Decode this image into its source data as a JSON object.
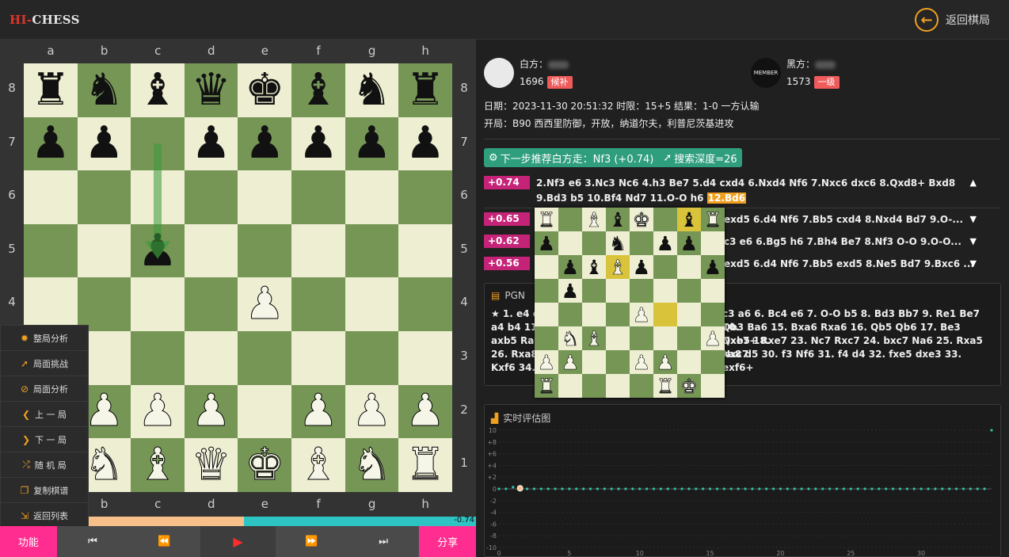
{
  "header": {
    "logo_red": "HI-",
    "logo_white": "CHESS",
    "back_label": "返回棋局",
    "back_icon": "arrow-left-circle-icon"
  },
  "board": {
    "files": [
      "a",
      "b",
      "c",
      "d",
      "e",
      "f",
      "g",
      "h"
    ],
    "ranks": [
      "8",
      "7",
      "6",
      "5",
      "4",
      "3",
      "2",
      "1"
    ],
    "rows": [
      "rnbqkbnr",
      "pp.ppppp",
      "........",
      "..p.....",
      "....P...",
      "........",
      "PPPP.PPP",
      "RNBQKBNR"
    ],
    "arrow": {
      "from": "c7",
      "to": "c5",
      "color": "#3a9a3a"
    }
  },
  "menu": [
    {
      "icon": "gear-icon",
      "label": "整局分析"
    },
    {
      "icon": "rocket-icon",
      "label": "局面挑战"
    },
    {
      "icon": "eye-slash-icon",
      "label": "局面分析"
    },
    {
      "icon": "chevron-left-icon",
      "label": "上 一 局"
    },
    {
      "icon": "chevron-right-icon",
      "label": "下 一 局"
    },
    {
      "icon": "shuffle-icon",
      "label": "随 机 局"
    },
    {
      "icon": "copy-icon",
      "label": "复制棋谱"
    },
    {
      "icon": "sign-out-icon",
      "label": "返回列表"
    }
  ],
  "evalbar": {
    "white_fraction": 0.4,
    "label": "-0.74"
  },
  "controls": {
    "func_label": "功能",
    "share_label": "分享",
    "first_icon": "skip-start-icon",
    "prev_icon": "rewind-icon",
    "play_icon": "play-icon",
    "next_icon": "fast-forward-icon",
    "last_icon": "skip-end-icon"
  },
  "players": {
    "white": {
      "side": "白方：",
      "rating": "1696",
      "badge": "候补"
    },
    "black": {
      "side": "黑方：",
      "rating": "1573",
      "badge": "一级",
      "avatar_text": "MEMBER"
    }
  },
  "meta": {
    "line1": "日期：2023-11-30 20:51:32 时限：15+5 结果：1-0 一方认输",
    "line2": "开局：B90 西西里防御，开放，纳道尔夫，利普尼茨基进攻"
  },
  "recommend": {
    "text": "下一步推荐白方走：Nf3 (+0.74)",
    "depth": "搜索深度=26"
  },
  "lines": [
    {
      "score": "+0.74",
      "moves": "2.Nf3 e6 3.Nc3 Nc6 4.h3 Be7 5.d4 cxd4 6.Nxd4 Nf6 7.Nxc6 dxc6 8.Qxd8+ Bxd8 9.Bd3 b5 10.Bf4 Nd7 11.O-O h6",
      "highlight": "12.Bd6"
    },
    {
      "score": "+0.65",
      "moves": "exd5 6.d4 Nf6 7.Bb5 cxd4 8.Nxd4 Bd7 9.O-..."
    },
    {
      "score": "+0.62",
      "moves": "c3 e6 6.Bg5 h6 7.Bh4 Be7 8.Nf3 O-O 9.O-O..."
    },
    {
      "score": "+0.56",
      "moves": "exd5 6.d4 Nf6 7.Bb5 exd5 8.Ne5 Bd7 9.Bxc6 ..."
    }
  ],
  "pgn": {
    "title": "PGN",
    "row1a": "★ 1. e4 c",
    "row1b": "c3 a6 6. Bc4 e6 7. O-O b5 8. Bd3 Bb7 9. Re1 Be7 10.",
    "row2a": "a4 b4 11.",
    "row2b": "Qb3 Ba6 15. Bxa6 Rxa6 16. Qb5 Qb6 17. Be3 Qxb5 18.",
    "row3a": "axb5 Ra6",
    "row3b": "Nxe7+ Rxe7 23. Nc7 Rxc7 24. bxc7 Na6 25. Rxa5 Nxc7",
    "row4a": "26. Rxa8",
    "row4b": "xa8 d5 30. f3 Nf6 31. f4 d4 32. fxe5 dxe3 33. exf6+",
    "row5a": "Kxf6 34."
  },
  "chart": {
    "title": "实时评估图"
  },
  "chart_data": {
    "type": "line",
    "title": "实时评估图",
    "y_ticks": [
      "10",
      "+8",
      "+6",
      "+4",
      "+2",
      "0",
      "-2",
      "-4",
      "-6",
      "-8",
      "-10"
    ],
    "x_ticks": [
      "0",
      "5",
      "10",
      "15",
      "20",
      "25",
      "30"
    ],
    "ylim": [
      -10,
      10
    ],
    "xlim": [
      0,
      35
    ],
    "series": [
      {
        "values": [
          0,
          0,
          0.3,
          0.1,
          0,
          0,
          0,
          0,
          0,
          0,
          0,
          0,
          0,
          0,
          0,
          0,
          0,
          0,
          0,
          0,
          0,
          0,
          0,
          0,
          0,
          0,
          0,
          0,
          0,
          0,
          0,
          0,
          0,
          0,
          0,
          0,
          0,
          0,
          0,
          0,
          0,
          0,
          0,
          0,
          0,
          0,
          0,
          0,
          0,
          0,
          0,
          0,
          0,
          0,
          0,
          0,
          0,
          0,
          0,
          0,
          0,
          0,
          0,
          0,
          0,
          0,
          0,
          0,
          0,
          0,
          10
        ]
      }
    ],
    "current_index": 3,
    "grid": true
  },
  "popup": {
    "rows": [
      "R.BbK.?R",
      "p..n.pp.",
      ".pb?p..p",
      ".p......",
      "....P*..",
      ".NB....P",
      "PP..PP..",
      "R....RK."
    ]
  }
}
